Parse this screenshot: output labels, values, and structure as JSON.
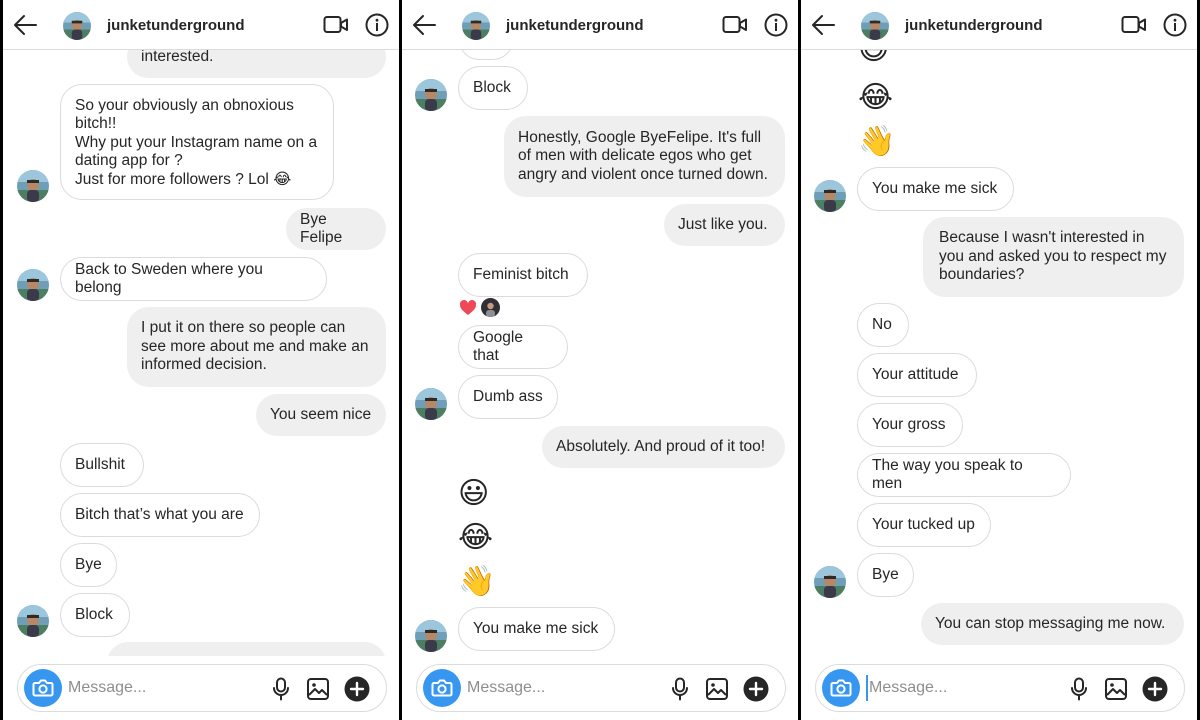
{
  "header": {
    "username": "junketunderground"
  },
  "composer": {
    "placeholder": "Message..."
  },
  "panels": [
    {
      "messages": [
        {
          "text": "interested.",
          "side": "out"
        },
        {
          "text": "So your obviously an obnoxious bitch!!\nWhy put your Instagram name on a dating app for ?\nJust for more followers ? Lol 😂",
          "side": "in"
        },
        {
          "text": "Bye Felipe",
          "side": "out"
        },
        {
          "text": "Back to Sweden where you belong",
          "side": "in"
        },
        {
          "text": "I put it on there so people can see more about me and make an informed decision.",
          "side": "out"
        },
        {
          "text": "You seem nice",
          "side": "out"
        },
        {
          "text": "Bullshit",
          "side": "in"
        },
        {
          "text": "Bitch that’s what you are",
          "side": "in"
        },
        {
          "text": "Bye",
          "side": "in"
        },
        {
          "text": "Block",
          "side": "in"
        }
      ]
    },
    {
      "messages": [
        {
          "text": "Block",
          "side": "in"
        },
        {
          "text": "Honestly, Google ByeFelipe. It's full of men with delicate egos who get angry and violent once turned down.",
          "side": "out"
        },
        {
          "text": "Just like you.",
          "side": "out"
        },
        {
          "text": "Feminist bitch",
          "side": "in"
        },
        {
          "text": "Google that",
          "side": "in"
        },
        {
          "text": "Dumb ass",
          "side": "in"
        },
        {
          "text": "Absolutely. And proud of it too!",
          "side": "out"
        },
        {
          "text": "😃",
          "side": "in"
        },
        {
          "text": "😂",
          "side": "in"
        },
        {
          "text": "👋",
          "side": "in"
        },
        {
          "text": "You make me sick",
          "side": "in"
        }
      ]
    },
    {
      "messages": [
        {
          "text": "😃",
          "side": "in"
        },
        {
          "text": "😂",
          "side": "in"
        },
        {
          "text": "👋",
          "side": "in"
        },
        {
          "text": "You make me sick",
          "side": "in"
        },
        {
          "text": "Because I wasn't interested in you and asked you to respect my boundaries?",
          "side": "out"
        },
        {
          "text": "No",
          "side": "in"
        },
        {
          "text": "Your attitude",
          "side": "in"
        },
        {
          "text": "Your gross",
          "side": "in"
        },
        {
          "text": "The way you speak to men",
          "side": "in"
        },
        {
          "text": "Your tucked up",
          "side": "in"
        },
        {
          "text": "Bye",
          "side": "in"
        },
        {
          "text": "You can stop messaging me now.",
          "side": "out"
        }
      ]
    }
  ],
  "reaction": {
    "emoji": "heart",
    "color": "#ed4956"
  },
  "colors": {
    "accent": "#3797f0",
    "incoming_border": "#dbdbdb",
    "outgoing_bg": "#efefef"
  }
}
